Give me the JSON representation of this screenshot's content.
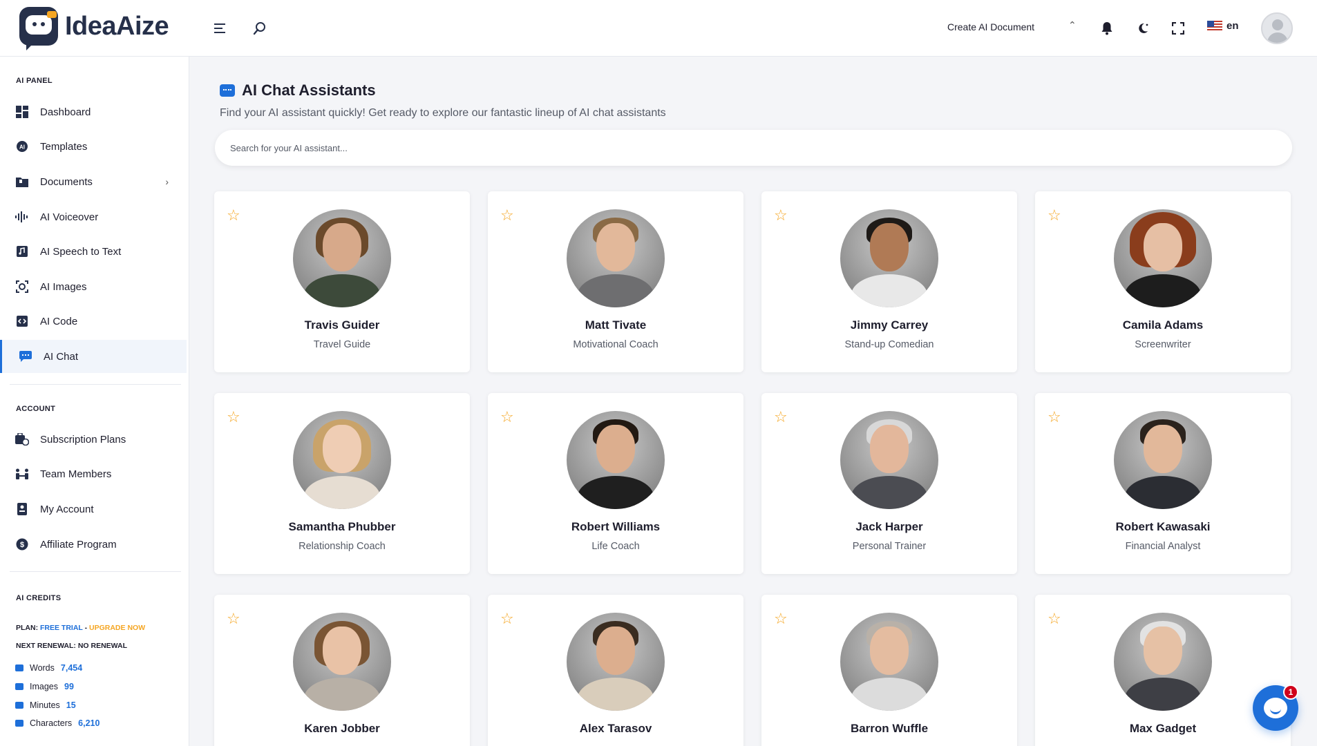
{
  "app": {
    "name": "IdeaAize"
  },
  "header": {
    "create_doc_label": "Create AI Document",
    "language": "en"
  },
  "sidebar": {
    "ai_panel_title": "AI PANEL",
    "ai_items": [
      {
        "label": "Dashboard",
        "icon": "dashboard-icon"
      },
      {
        "label": "Templates",
        "icon": "templates-icon"
      },
      {
        "label": "Documents",
        "icon": "documents-icon"
      },
      {
        "label": "AI Voiceover",
        "icon": "voiceover-icon"
      },
      {
        "label": "AI Speech to Text",
        "icon": "speech-icon"
      },
      {
        "label": "AI Images",
        "icon": "images-icon"
      },
      {
        "label": "AI Code",
        "icon": "code-icon"
      },
      {
        "label": "AI Chat",
        "icon": "chat-icon",
        "active": true
      }
    ],
    "account_title": "ACCOUNT",
    "account_items": [
      {
        "label": "Subscription Plans",
        "icon": "subscription-icon"
      },
      {
        "label": "Team Members",
        "icon": "team-icon"
      },
      {
        "label": "My Account",
        "icon": "account-icon"
      },
      {
        "label": "Affiliate Program",
        "icon": "affiliate-icon"
      }
    ],
    "credits_title": "AI CREDITS",
    "plan_prefix": "PLAN:",
    "plan_name": "FREE TRIAL",
    "plan_sep": "-",
    "upgrade_label": "UPGRADE NOW",
    "renewal": "NEXT RENEWAL: NO RENEWAL",
    "credits": [
      {
        "label": "Words",
        "value": "7,454"
      },
      {
        "label": "Images",
        "value": "99"
      },
      {
        "label": "Minutes",
        "value": "15"
      },
      {
        "label": "Characters",
        "value": "6,210"
      }
    ]
  },
  "main": {
    "title": "AI Chat Assistants",
    "subtitle": "Find your AI assistant quickly! Get ready to explore our fantastic lineup of AI chat assistants",
    "search_placeholder": "Search for your AI assistant...",
    "assistants": [
      {
        "name": "Travis Guider",
        "role": "Travel Guide"
      },
      {
        "name": "Matt Tivate",
        "role": "Motivational Coach"
      },
      {
        "name": "Jimmy Carrey",
        "role": "Stand-up Comedian"
      },
      {
        "name": "Camila Adams",
        "role": "Screenwriter"
      },
      {
        "name": "Samantha Phubber",
        "role": "Relationship Coach"
      },
      {
        "name": "Robert Williams",
        "role": "Life Coach"
      },
      {
        "name": "Jack Harper",
        "role": "Personal Trainer"
      },
      {
        "name": "Robert Kawasaki",
        "role": "Financial Analyst"
      },
      {
        "name": "Karen Jobber",
        "role": ""
      },
      {
        "name": "Alex Tarasov",
        "role": ""
      },
      {
        "name": "Barron Wuffle",
        "role": ""
      },
      {
        "name": "Max Gadget",
        "role": ""
      }
    ]
  },
  "chat_widget": {
    "badge_count": "1"
  },
  "colors": {
    "accent": "#1e6fd9",
    "star": "#f5a623",
    "upgrade": "#f5a623",
    "badge": "#d0021b"
  }
}
